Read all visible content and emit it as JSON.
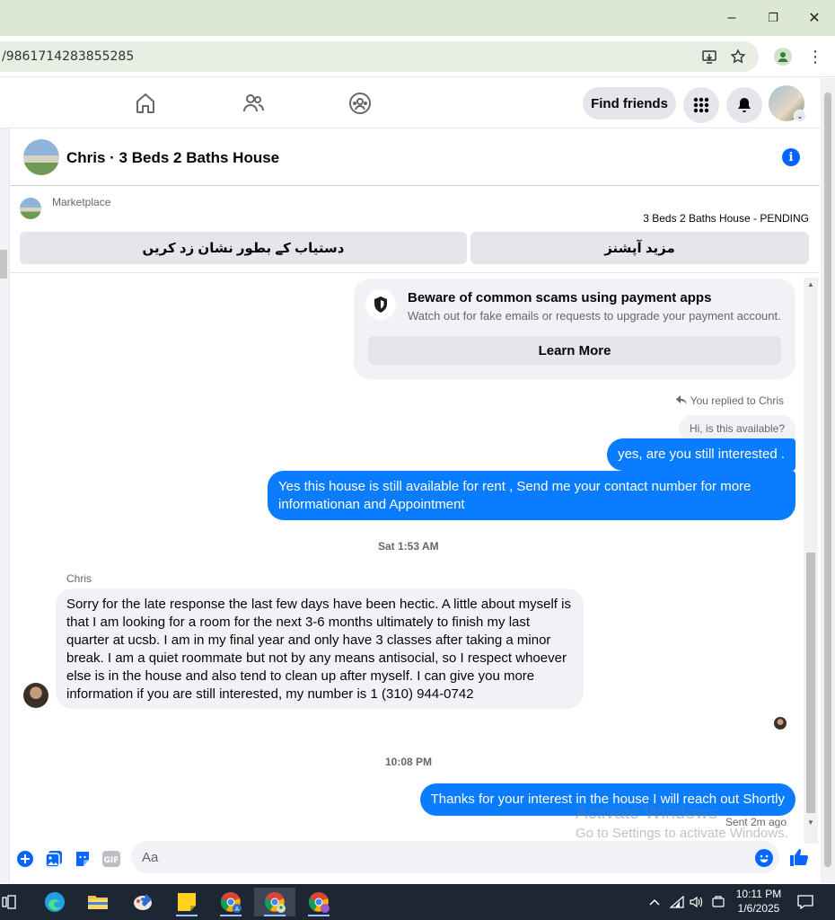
{
  "browser": {
    "url": "/9861714283855285",
    "window_controls": {
      "minimize": "–",
      "restore": "❐",
      "close": "✕"
    }
  },
  "fb_header": {
    "find_friends_label": "Find friends",
    "nav_icons": [
      "home-icon",
      "friends-icon",
      "groups-icon"
    ]
  },
  "chat": {
    "title": "Chris · 3 Beds 2 Baths House",
    "marketplace_label": "Marketplace",
    "listing_status": "3 Beds 2 Baths House - PENDING",
    "actions": {
      "mark_available": "دستیاب کے بطور نشان زد کریں",
      "more_options": "مزید آپشنز"
    },
    "scam_notice": {
      "title": "Beware of common scams using payment apps",
      "subtitle": "Watch out for fake emails or requests to upgrade your payment account.",
      "button": "Learn More"
    },
    "replied_label": "You replied to Chris",
    "quoted_message": "Hi, is this available?",
    "messages": [
      {
        "from": "me",
        "text": "yes, are you still interested ."
      },
      {
        "from": "me",
        "text": "Yes this house is still available for rent , Send me your contact number for more informationan and Appointment"
      },
      {
        "from": "chris",
        "sender": "Chris",
        "text": "Sorry for the late response the last few days have been hectic. A little about myself is that I am looking for a room for the next 3-6 months ultimately to finish my last quarter at ucsb. I am in my final year and only have 3 classes after taking a minor break. I am a quiet roommate but not by any means antisocial, so I respect whoever else is in the house and also tend to clean up after myself.  I can give you more information if you are still interested, my number is 1 (310) 944-0742"
      },
      {
        "from": "me",
        "text": "Thanks for your interest in the house I will reach out Shortly"
      }
    ],
    "timestamps": {
      "first": "Sat 1:53 AM",
      "second": "10:08 PM"
    },
    "sent_label": "Sent 2m ago",
    "composer": {
      "placeholder": "Aa"
    }
  },
  "watermark": {
    "line1": "Activate Windows",
    "line2": "Go to Settings to activate Windows."
  },
  "taskbar": {
    "time": "10:11 PM",
    "date": "1/6/2025"
  },
  "colors": {
    "brand_blue": "#0866ff",
    "bubble_out": "#0a7cff",
    "bubble_in": "#f0f2f5",
    "titlebar": "#dce8d3"
  }
}
